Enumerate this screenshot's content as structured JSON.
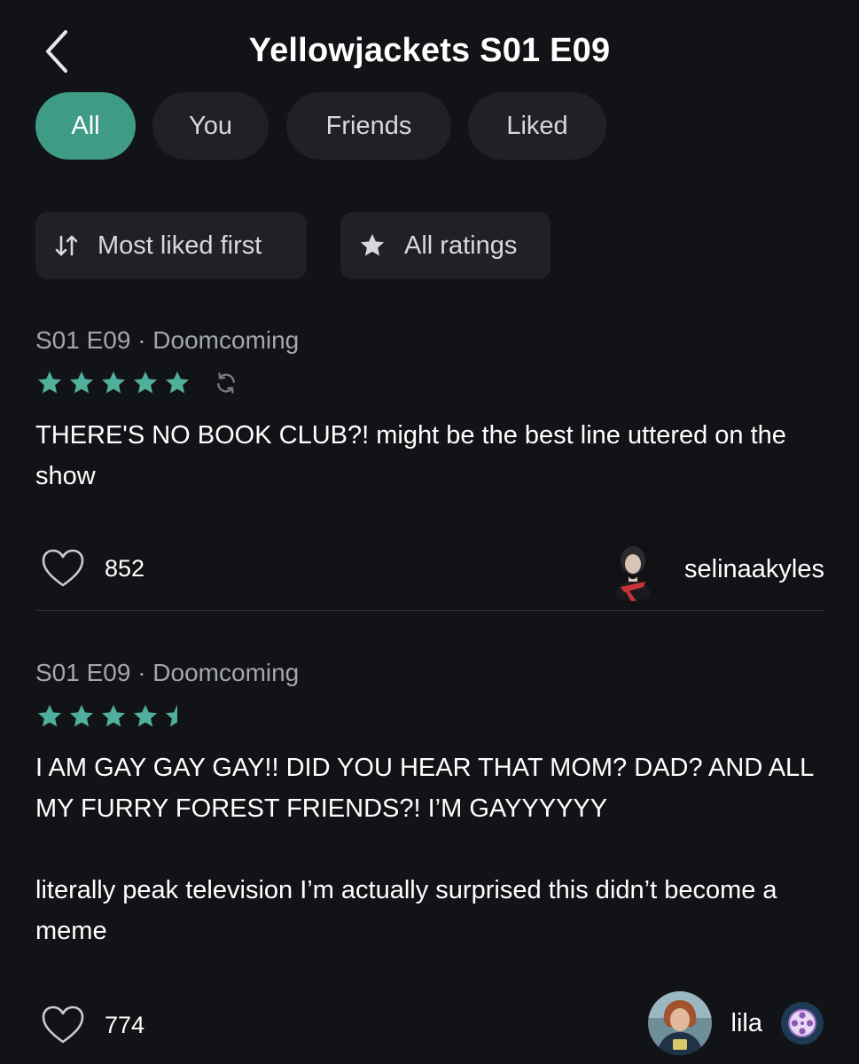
{
  "header": {
    "title": "Yellowjackets S01 E09",
    "back_icon": "chevron-left-icon"
  },
  "filters": [
    {
      "label": "All",
      "active": true
    },
    {
      "label": "You",
      "active": false
    },
    {
      "label": "Friends",
      "active": false
    },
    {
      "label": "Liked",
      "active": false
    }
  ],
  "sort": {
    "label": "Most liked first",
    "icon": "sort-arrows-icon"
  },
  "rating_filter": {
    "label": "All ratings",
    "icon": "star-icon"
  },
  "colors": {
    "accent": "#3f9a86",
    "star": "#4fb09b",
    "background": "#121316",
    "chip": "#1f2124"
  },
  "reviews": [
    {
      "episode": "S01 E09 · Doomcoming",
      "rating": 5,
      "rewatch_icon": "rewatch-icon",
      "text": "THERE'S NO BOOK CLUB?! might be the best line uttered on the show",
      "likes": "852",
      "username": "selinaakyles"
    },
    {
      "episode": "S01 E09 · Doomcoming",
      "rating": 4.5,
      "text": "I AM GAY GAY GAY!! DID YOU HEAR THAT MOM? DAD? AND ALL MY FURRY FOREST FRIENDS?! I’M GAYYYYYY\n\nliterally peak television I’m actually surprised this didn’t become a meme",
      "likes": "774",
      "username": "lila",
      "badge_icon": "film-reel-badge-icon"
    }
  ]
}
